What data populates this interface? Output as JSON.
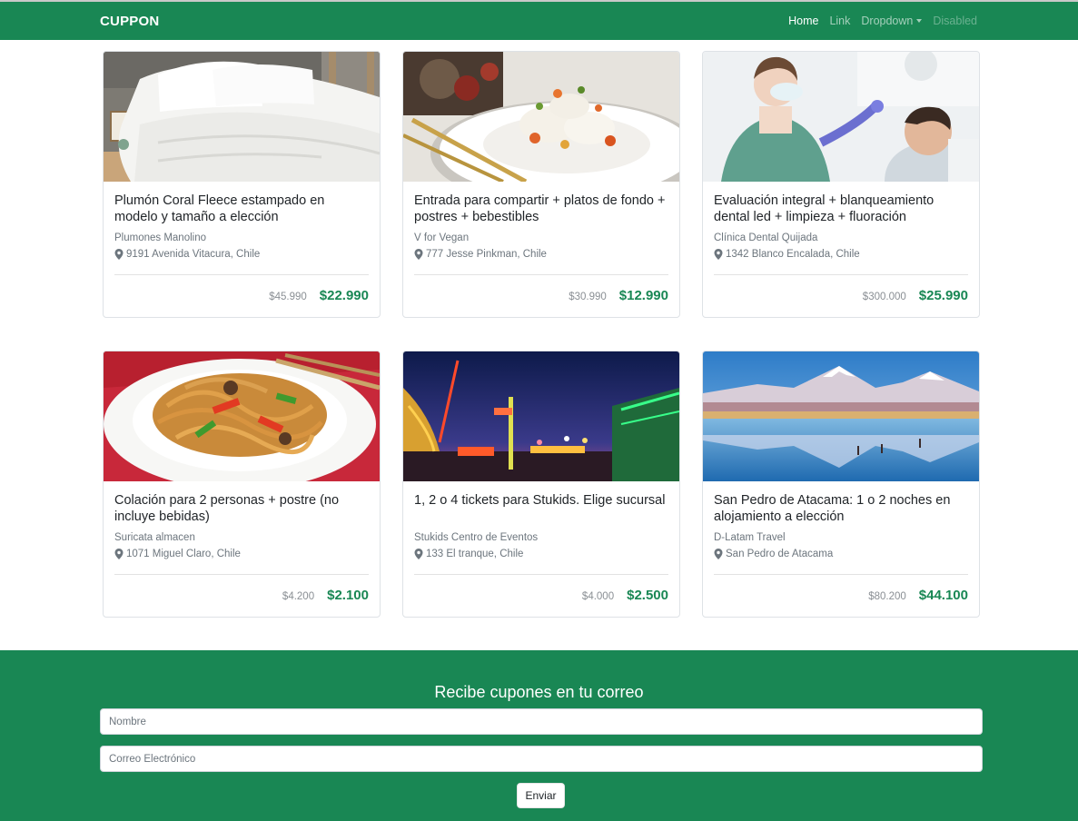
{
  "navbar": {
    "brand": "CUPPON",
    "links": [
      {
        "label": "Home"
      },
      {
        "label": "Link"
      },
      {
        "label": "Dropdown"
      },
      {
        "label": "Disabled"
      }
    ]
  },
  "deals": [
    {
      "title": "Plumón Coral Fleece estampado en modelo y tamaño a elección",
      "merchant": "Plumones Manolino",
      "location": "9191 Avenida Vitacura, Chile",
      "old_price": "$45.990",
      "price": "$22.990",
      "image": "white duvet bedding"
    },
    {
      "title": "Entrada para compartir + platos de fondo + postres + bebestibles",
      "merchant": "V for Vegan",
      "location": "777 Jesse Pinkman, Chile",
      "old_price": "$30.990",
      "price": "$12.990",
      "image": "plated fish dish"
    },
    {
      "title": "Evaluación integral + blanqueamiento dental led + limpieza + fluoración",
      "merchant": "Clínica Dental Quijada",
      "location": "1342 Blanco Encalada, Chile",
      "old_price": "$300.000",
      "price": "$25.990",
      "image": "dentist with patient"
    },
    {
      "title": "Colación para 2 personas + postre (no incluye bebidas)",
      "merchant": "Suricata almacen",
      "location": "1071 Miguel Claro, Chile",
      "old_price": "$4.200",
      "price": "$2.100",
      "image": "noodle stir fry"
    },
    {
      "title": "1, 2 o 4 tickets para Stukids. Elige sucursal",
      "merchant": "Stukids Centro de Eventos",
      "location": "133 El tranque, Chile",
      "old_price": "$4.000",
      "price": "$2.500",
      "image": "amusement park at night"
    },
    {
      "title": "San Pedro de Atacama: 1 o 2 noches en alojamiento a elección",
      "merchant": "D-Latam Travel",
      "location": "San Pedro de Atacama",
      "old_price": "$80.200",
      "price": "$44.100",
      "image": "snowy volcanoes reflected in lagoon"
    }
  ],
  "newsletter": {
    "heading": "Recibe cupones en tu correo",
    "name_placeholder": "Nombre",
    "email_placeholder": "Correo Electrónico",
    "submit_label": "Enviar"
  },
  "colors": {
    "brand_green": "#198754",
    "price_green": "#198754"
  },
  "icons": {
    "location": "map-pin-icon",
    "dropdown": "caret-down-icon"
  }
}
